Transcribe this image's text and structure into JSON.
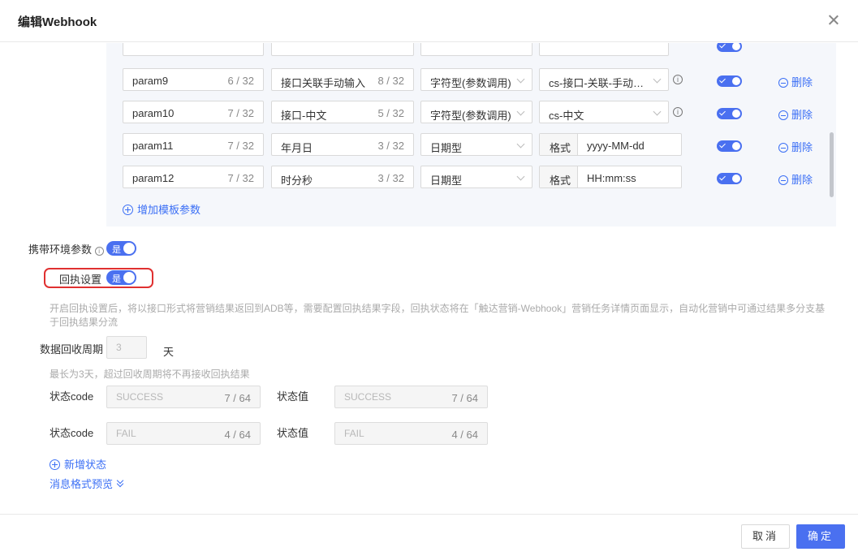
{
  "dialog": {
    "title": "编辑Webhook"
  },
  "params": [
    {
      "name": "param9",
      "name_count": "6 / 32",
      "label": "接口关联手动输入",
      "label_count": "8 / 32",
      "type": "字符型(参数调用)",
      "value": "cs-接口-关联-手动…",
      "kind": "select"
    },
    {
      "name": "param10",
      "name_count": "7 / 32",
      "label": "接口-中文",
      "label_count": "5 / 32",
      "type": "字符型(参数调用)",
      "value": "cs-中文",
      "kind": "select"
    },
    {
      "name": "param11",
      "name_count": "7 / 32",
      "label": "年月日",
      "label_count": "3 / 32",
      "type": "日期型",
      "format_label": "格式",
      "format": "yyyy-MM-dd",
      "kind": "format"
    },
    {
      "name": "param12",
      "name_count": "7 / 32",
      "label": "时分秒",
      "label_count": "3 / 32",
      "type": "日期型",
      "format_label": "格式",
      "format": "HH:mm:ss",
      "kind": "format"
    }
  ],
  "row_delete_label": "删除",
  "add_param_label": "增加模板参数",
  "env_param": {
    "label": "携带环境参数",
    "switch_text": "是"
  },
  "callback": {
    "label": "回执设置",
    "switch_text": "是",
    "hint_line1": "开启回执设置后，将以接口形式将营销结果返回到ADB等，需要配置回执结果字段，回执状态将在「触达营销-Webhook」营销任务详情页面显示，自动化营销中可通过结果多分支基",
    "hint_line2": "于回执结果分流"
  },
  "recovery": {
    "label": "数据回收周期",
    "value": "3",
    "unit": "天",
    "hint": "最长为3天，超过回收周期将不再接收回执结果"
  },
  "statuses": [
    {
      "code_label": "状态code",
      "code": "SUCCESS",
      "code_count": "7 / 64",
      "value_label": "状态值",
      "value": "SUCCESS",
      "value_count": "7 / 64"
    },
    {
      "code_label": "状态code",
      "code": "FAIL",
      "code_count": "4 / 64",
      "value_label": "状态值",
      "value": "FAIL",
      "value_count": "4 / 64"
    }
  ],
  "add_status_label": "新增状态",
  "preview_label": "消息格式预览",
  "footer": {
    "cancel": "取消",
    "ok": "确定"
  },
  "colors": {
    "accent": "#4a70f0",
    "link": "#3b6ff5",
    "highlight": "#e03030"
  }
}
